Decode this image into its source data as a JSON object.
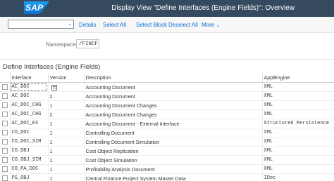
{
  "shell": {
    "logo_text": "SAP",
    "title": "Display View \"Define Interfaces (Engine Fields)\": Overview"
  },
  "toolbar": {
    "command_placeholder": "",
    "buttons": [
      "Details",
      "Select All",
      "Select Block",
      "Deselect All",
      "More"
    ]
  },
  "namespace": {
    "label": "Namespace:",
    "value": "/FINCF"
  },
  "section": {
    "title": "Define Interfaces (Engine Fields)"
  },
  "table": {
    "columns": [
      "Interface",
      "Version",
      "Description",
      "ApplEngine"
    ],
    "rows": [
      {
        "interface": "AC_DOC",
        "version": "",
        "description": "Accounting Document",
        "engine": "XML"
      },
      {
        "interface": "AC_DOC",
        "version": "2",
        "description": "Accounting Document",
        "engine": "XML"
      },
      {
        "interface": "AC_DOC_CHG",
        "version": "1",
        "description": "Accounting Document Changes",
        "engine": "XML"
      },
      {
        "interface": "AC_DOC_CHG",
        "version": "2",
        "description": "Accounting Document Changes",
        "engine": "XML"
      },
      {
        "interface": "AC_DOC_EX",
        "version": "1",
        "description": "Accounting Document - External Interface",
        "engine": "Structured Persistence"
      },
      {
        "interface": "CO_DOC",
        "version": "1",
        "description": "Controlling Document",
        "engine": "XML"
      },
      {
        "interface": "CO_DOC_SIM",
        "version": "1",
        "description": "Controlling Document Simulation",
        "engine": "XML"
      },
      {
        "interface": "CO_OBJ",
        "version": "1",
        "description": "Cost Object Replication",
        "engine": "XML"
      },
      {
        "interface": "CO_OBJ_SIM",
        "version": "1",
        "description": "Cost Object Simulation",
        "engine": "XML"
      },
      {
        "interface": "CO_PA_DOC",
        "version": "1",
        "description": "Profitability Analysis Document",
        "engine": "XML"
      },
      {
        "interface": "PS_OBJ",
        "version": "1",
        "description": "Central Finance Project System Master Data",
        "engine": "IDoc"
      }
    ]
  },
  "icons": {
    "more_chevron": "chevron-down-icon",
    "value_help": "value-help-icon"
  },
  "colors": {
    "shell_bg": "#354a5f",
    "link": "#0a6ed1",
    "logo": "#0a6ed1"
  }
}
